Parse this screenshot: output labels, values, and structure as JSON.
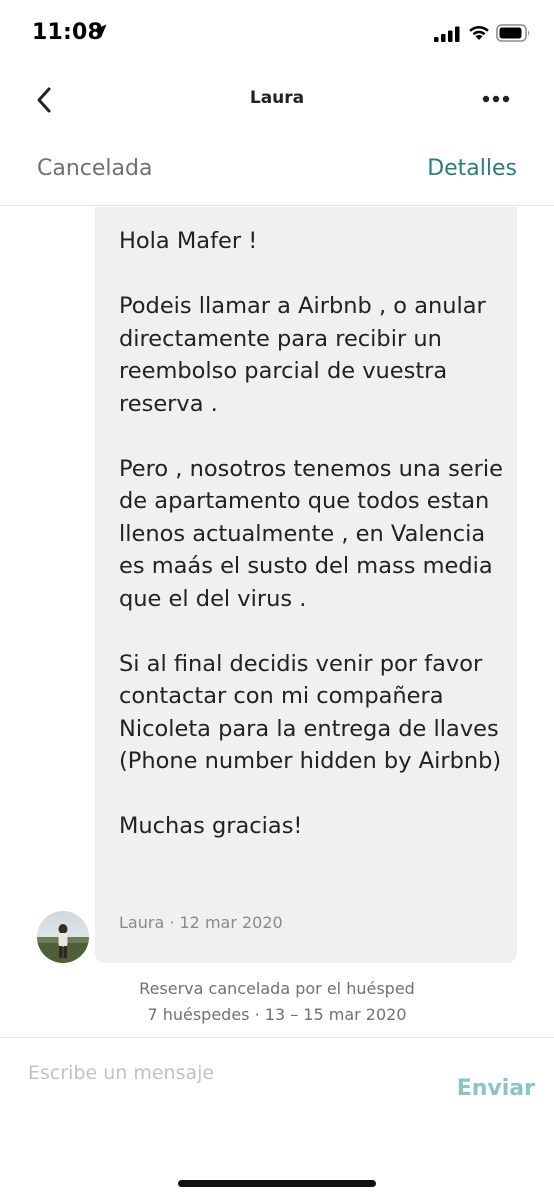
{
  "status_bar": {
    "time": "11:08"
  },
  "nav": {
    "title": "Laura",
    "back_icon": "chevron-left-icon",
    "more_icon": "more-horizontal-icon"
  },
  "reservation": {
    "status": "Cancelada",
    "details_link": "Detalles"
  },
  "message": {
    "body": "Hola Mafer !\n\nPodeis llamar a Airbnb , o anular directamente para recibir un reembolso parcial de vuestra reserva .\n\nPero , nosotros tenemos una serie de apartamento que todos estan llenos actualmente , en Valencia es maás el susto del mass media que el del virus .\n\nSi al final decidis venir por favor contactar con mi compañera Nicoleta para la entrega de llaves (Phone number hidden by Airbnb)\n\nMuchas gracias!",
    "meta": "Laura · 12 mar 2020"
  },
  "system_note": {
    "line1": "Reserva cancelada por el huésped",
    "line2": "7 huéspedes · 13 – 15 mar 2020"
  },
  "composer": {
    "placeholder": "Escribe un mensaje",
    "send_label": "Enviar"
  },
  "colors": {
    "accent": "#2b7d7d",
    "send_disabled": "#8cc3c5",
    "bubble_bg": "#f0f0f0",
    "muted_text": "#717171"
  }
}
